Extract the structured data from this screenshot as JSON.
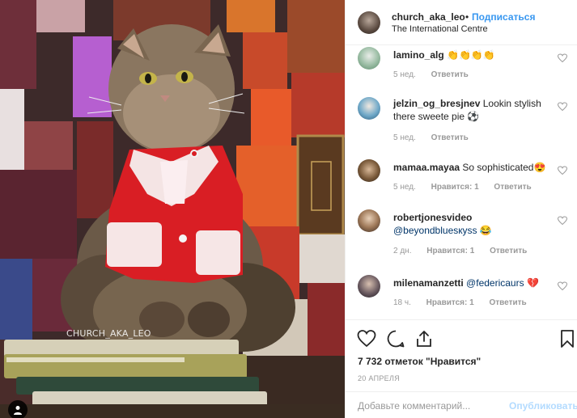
{
  "photo": {
    "watermark": "CHURCH_AKA_LEO",
    "user_tag_icon": "person-icon"
  },
  "header": {
    "username": "church_aka_leo",
    "separator": "•",
    "follow_label": "Подписаться",
    "location": "The International Centre"
  },
  "comments": [
    {
      "username": "lamino_alg",
      "text": "👏👏👏👏",
      "time": "5 нед.",
      "likes": "",
      "reply": "Ответить"
    },
    {
      "username": "jelzin_og_bresjnev",
      "text": "Lookin stylish there sweete pie ⚽",
      "time": "5 нед.",
      "likes": "",
      "reply": "Ответить"
    },
    {
      "username": "mamaa.mayaa",
      "text": "So sophisticated😍",
      "time": "5 нед.",
      "likes": "Нравится: 1",
      "reply": "Ответить"
    },
    {
      "username": "robertjonesvideo",
      "mention": "@beyondbluesкyss",
      "text": "😂",
      "time": "2 дн.",
      "likes": "Нравится: 1",
      "reply": "Ответить"
    },
    {
      "username": "milenamanzetti",
      "mention": "@federicaurs",
      "text": "💔",
      "time": "18 ч.",
      "likes": "Нравится: 1",
      "reply": "Ответить"
    }
  ],
  "likes_count": "7 732 отметок \"Нравится\"",
  "date": "20 АПРЕЛЯ",
  "add_comment": {
    "placeholder": "Добавьте комментарий...",
    "publish_label": "Опубликовать"
  },
  "colors": {
    "link_blue": "#3897f0",
    "publish_disabled": "#b3dbff",
    "meta_gray": "#999999"
  }
}
